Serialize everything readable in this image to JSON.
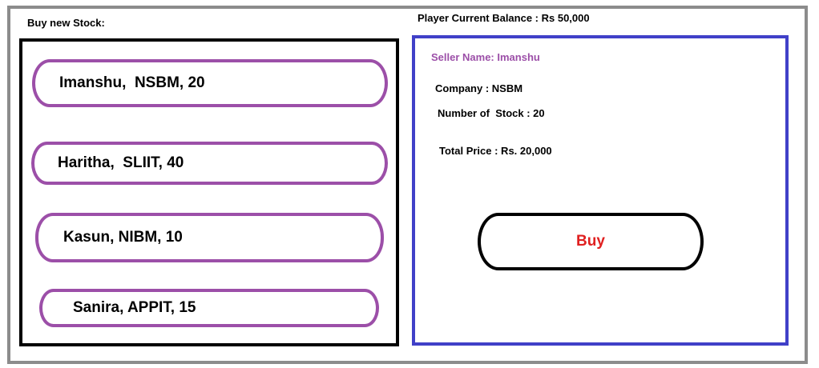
{
  "header": {
    "title": "Buy new Stock:",
    "balance": "Player Current Balance : Rs 50,000"
  },
  "listings": [
    {
      "label": "Imanshu,  NSBM, 20"
    },
    {
      "label": "Haritha,  SLIIT, 40"
    },
    {
      "label": "Kasun, NIBM, 10"
    },
    {
      "label": "Sanira, APPIT, 15"
    }
  ],
  "details": {
    "seller": "Seller Name: Imanshu",
    "company": "Company : NSBM",
    "stock_count": "Number of  Stock : 20",
    "total_price": "Total Price : Rs. 20,000",
    "buy_label": "Buy"
  },
  "colors": {
    "frame": "#8c8c8c",
    "list_border": "#9c4fa8",
    "detail_border": "#4040c8",
    "buy_text": "#e02020"
  }
}
